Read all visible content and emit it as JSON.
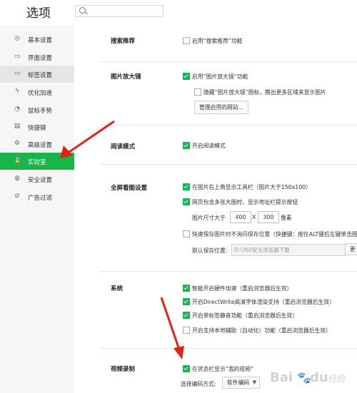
{
  "app": {
    "title": "选项"
  },
  "search": {
    "placeholder": ""
  },
  "sidebar": {
    "items": [
      {
        "label": "基本设置",
        "icon": "◎"
      },
      {
        "label": "界面设置",
        "icon": "▭"
      },
      {
        "label": "标签设置",
        "icon": "▭"
      },
      {
        "label": "优化加速",
        "icon": "ϟ"
      },
      {
        "label": "鼠标手势",
        "icon": "◔"
      },
      {
        "label": "快捷键",
        "icon": "▤"
      },
      {
        "label": "高级设置",
        "icon": "⚙"
      },
      {
        "label": "实验室",
        "icon": "⌛"
      },
      {
        "label": "安全设置",
        "icon": "◍"
      },
      {
        "label": "广告过滤",
        "icon": "⊘"
      }
    ]
  },
  "sections": {
    "search_recommend": {
      "title": "搜索推荐",
      "opt1": "启用“搜索推荐”功能"
    },
    "magnifier": {
      "title": "图片放大镜",
      "opt1": "启用“图片放大镜”功能",
      "opt2": "隐藏“图片放大镜”图标，腾出更多区域来显示图片",
      "btn": "管理启用的网站..."
    },
    "reading": {
      "title": "阅读模式",
      "opt1": "开启阅读模式"
    },
    "fullscreen": {
      "title": "全屏看图设置",
      "opt1": "在图片右上角显示工具栏（图片大于150x100）",
      "opt2": "网页包含多张大图时，显示地址栏提示按钮",
      "size_label": "图片尺寸大于",
      "width": "400",
      "x": "X",
      "height": "300",
      "unit": "像素",
      "opt3": "快速保存图片时不询问保存位置（快捷键：按住ALT键后左键单击图",
      "default_path_label": "默认保存位置:",
      "path": "D:\\360安全浏览器下载",
      "change_btn": "更"
    },
    "system": {
      "title": "系统",
      "opt1": "智能开启硬件加速（重启浏览器后生效）",
      "opt2": "开启DirectWrite高清字体渲染支持（重启浏览器后生效）",
      "opt3": "开启单标签静音功能（重启浏览器后生效）",
      "opt4": "开启支持本地辅助（自动化）功能（重启浏览器后生效）"
    },
    "video": {
      "title": "视频录制",
      "opt1": "在状态栏显示“我的视频”",
      "codec_label": "选择编码方式:",
      "codec_value": "软件编码"
    }
  },
  "watermark": {
    "text": "Bai du 经验"
  },
  "colors": {
    "accent": "#19b451",
    "arrow": "#e2231a"
  }
}
